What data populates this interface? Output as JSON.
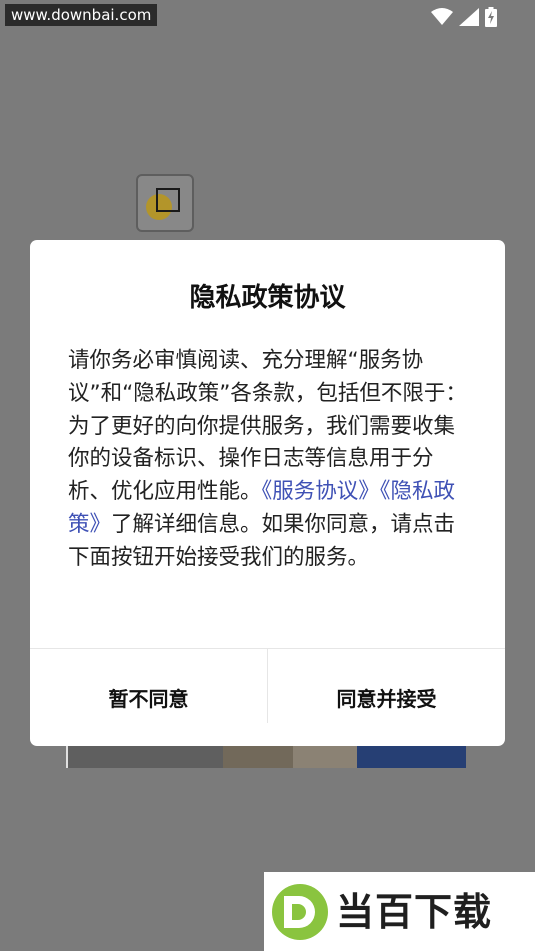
{
  "watermark_top": "www.downbai.com",
  "dialog": {
    "title": "隐私政策协议",
    "body_text": "请你务必审慎阅读、充分理解“服务协议”和“隐私政策”各条款，包括但不限于：为了更好的向你提供服务，我们需要收集你的设备标识、操作日志等信息用于分析、优化应用性能。",
    "link_service": "《服务协议》",
    "link_privacy": "《隐私政策》",
    "body_tail": "了解详细信息。如果你同意，请点击下面按钮开始接受我们的服务。",
    "decline_label": "暂不同意",
    "accept_label": "同意并接受"
  },
  "brand": {
    "name": "当百下载",
    "logo_letter": "D"
  },
  "status_icons": [
    "wifi-icon",
    "signal-icon",
    "battery-charging-icon"
  ],
  "colors": {
    "overlay": "#7b7b7b",
    "link": "#3f51b5",
    "brand_green": "#8ac43f"
  }
}
